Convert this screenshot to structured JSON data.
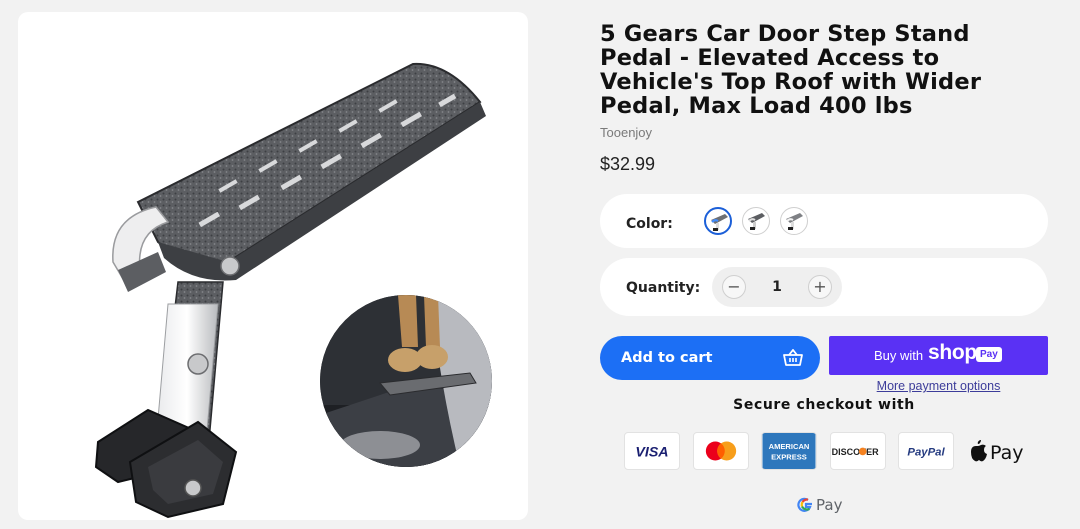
{
  "product": {
    "title_lines": [
      "5 Gears Car Door Step Stand",
      "Pedal - Elevated Access to",
      "Vehicle's Top Roof with Wider",
      "Pedal, Max Load 400 lbs"
    ],
    "vendor": "Tooenjoy",
    "price": "$32.99"
  },
  "options": {
    "color_label": "Color:",
    "swatches": [
      "blue-accent variant",
      "gray variant",
      "silver variant"
    ],
    "selected_swatch": 0,
    "quantity_label": "Quantity:",
    "quantity_value": "1",
    "minus_symbol": "−",
    "plus_symbol": "+"
  },
  "actions": {
    "add_to_cart": "Add to cart",
    "buy_with": "Buy with",
    "shop_word": "shop",
    "pay_word": "Pay",
    "more_payment": "More payment options"
  },
  "checkout": {
    "secure_label": "Secure checkout with",
    "methods": [
      "VISA",
      "Mastercard",
      "AMERICAN EXPRESS",
      "DISCOVER",
      "PayPal",
      "Apple Pay",
      "Google Pay"
    ],
    "visa_text": "VISA",
    "amex_line1": "AMERICAN",
    "amex_line2": "EXPRESS",
    "discover_text": "DISCOVER",
    "paypal_text": "PayPal",
    "applepay_text": "Pay",
    "gpay_text": "Pay"
  },
  "colors": {
    "accent_blue": "#1c6ff5",
    "shop_purple": "#5a31f4",
    "background": "#f2f2f2"
  }
}
